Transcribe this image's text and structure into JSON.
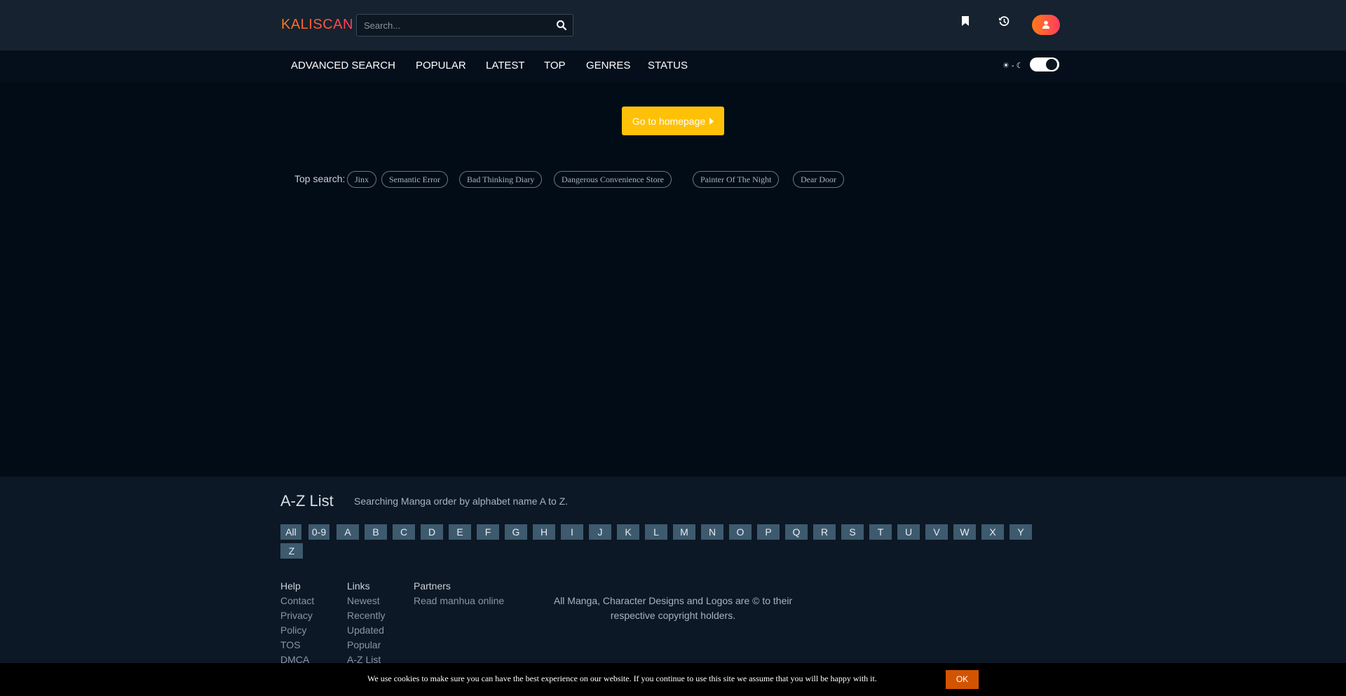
{
  "header": {
    "logo": "KALISCAN",
    "search_placeholder": "Search...",
    "icons": [
      "bookmark-icon",
      "history-icon",
      "user-icon"
    ]
  },
  "nav": {
    "items": [
      "ADVANCED SEARCH",
      "POPULAR",
      "LATEST",
      "TOP",
      "GENRES",
      "STATUS"
    ],
    "theme_label": "☀ - ☾",
    "dark_mode": true
  },
  "main": {
    "home_button": "Go to homepage",
    "top_search_label": "Top search:",
    "top_searches": [
      "Jinx",
      "Semantic Error",
      "Bad Thinking Diary",
      "Dangerous Convenience Store",
      "Painter Of The Night",
      "Dear Door"
    ]
  },
  "footer": {
    "az_title": "A-Z List",
    "az_desc": "Searching Manga order by alphabet name A to Z.",
    "letters": [
      "All",
      "0-9",
      "A",
      "B",
      "C",
      "D",
      "E",
      "F",
      "G",
      "H",
      "I",
      "J",
      "K",
      "L",
      "M",
      "N",
      "O",
      "P",
      "Q",
      "R",
      "S",
      "T",
      "U",
      "V",
      "W",
      "X",
      "Y",
      "Z"
    ],
    "help": {
      "title": "Help",
      "links": [
        "Contact",
        "Privacy",
        "Policy",
        "TOS",
        "DMCA"
      ]
    },
    "links": {
      "title": "Links",
      "links": [
        "Newest",
        "Recently",
        "Updated",
        "Popular",
        "A-Z List"
      ]
    },
    "partners": {
      "title": "Partners",
      "links": [
        "Read manhua online"
      ]
    },
    "copyright": "All Manga, Character Designs and Logos are © to their respective copyright holders."
  },
  "cookie": {
    "text": "We use cookies to make sure you can have the best experience on our website. If you continue to use this site we assume that you will be happy with it.",
    "ok": "OK"
  },
  "colors": {
    "accent_orange": "#ff7a18",
    "accent_pink": "#ff3c5f",
    "home_button": "#ffc107",
    "letter_bg": "#3e5a6e",
    "cookie_ok": "#d35400"
  }
}
